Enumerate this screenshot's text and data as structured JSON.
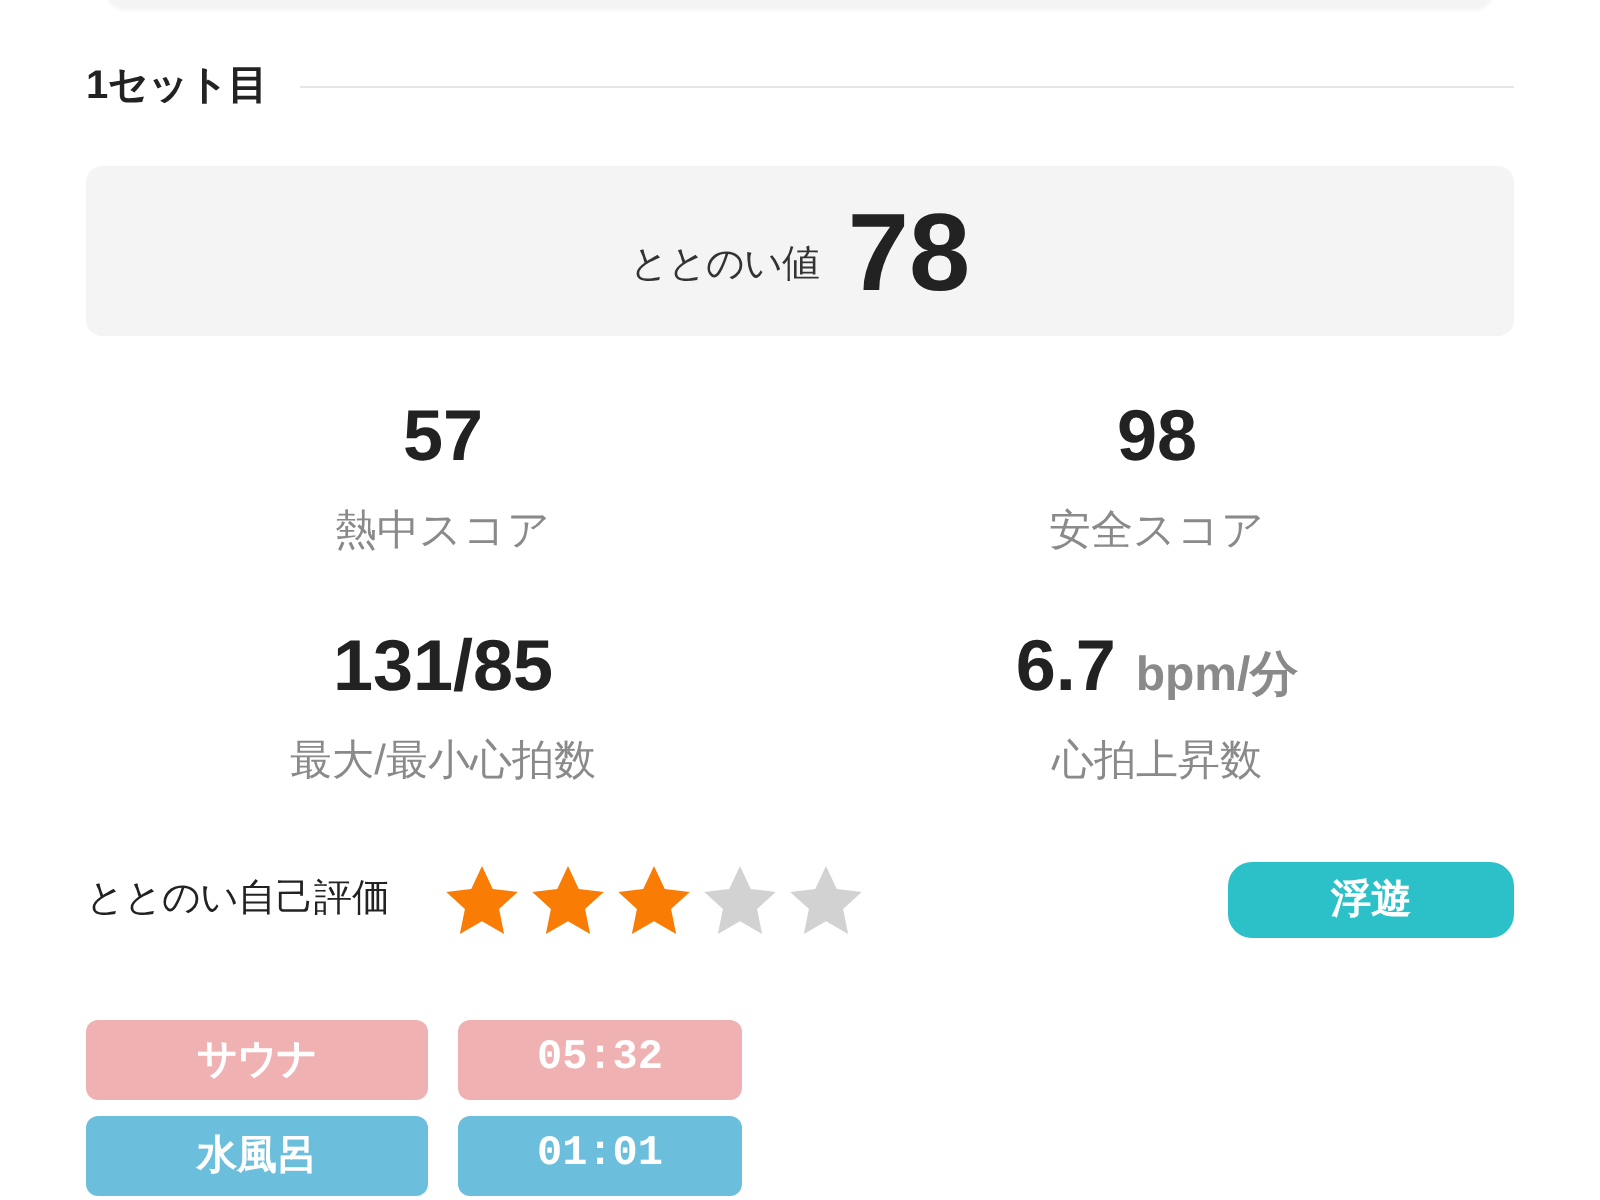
{
  "set_heading": "1セット目",
  "totonoi_score": {
    "label": "ととのい値",
    "value": "78"
  },
  "metrics": [
    {
      "value": "57",
      "label": "熱中スコア"
    },
    {
      "value": "98",
      "label": "安全スコア"
    },
    {
      "value": "131/85",
      "label": "最大/最小心拍数"
    },
    {
      "value": "6.7",
      "unit": "bpm/分",
      "label": "心拍上昇数"
    }
  ],
  "self_rating": {
    "label": "ととのい自己評価",
    "stars": 3,
    "state_badge": "浮遊"
  },
  "phases": [
    {
      "name": "サウナ",
      "time": "05:32",
      "color": "#efb1b1"
    },
    {
      "name": "水風呂",
      "time": "01:01",
      "color": "#6cbfdc"
    }
  ]
}
